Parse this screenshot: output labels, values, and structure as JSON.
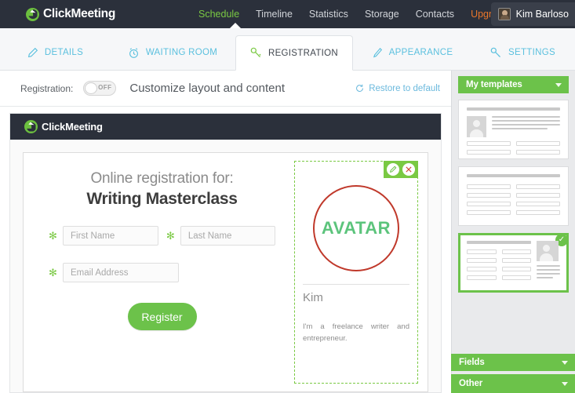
{
  "topbar": {
    "brand": "ClickMeeting",
    "brand_logo_icon": "clickmeeting-cursor-logo",
    "nav": [
      {
        "label": "Schedule",
        "state": "active"
      },
      {
        "label": "Timeline",
        "state": "normal"
      },
      {
        "label": "Statistics",
        "state": "normal"
      },
      {
        "label": "Storage",
        "state": "normal"
      },
      {
        "label": "Contacts",
        "state": "normal"
      },
      {
        "label": "Upgrade",
        "state": "upgrade"
      }
    ],
    "user_name": "Kim Barloso",
    "user_avatar_icon": "user-avatar-thumbnail",
    "colors": {
      "bg": "#2b303b",
      "active": "#7ac943",
      "upgrade": "#e8762b"
    }
  },
  "tabs": [
    {
      "label": "DETAILS",
      "icon": "pencil-icon",
      "active": false
    },
    {
      "label": "WAITING ROOM",
      "icon": "alarm-clock-icon",
      "active": false
    },
    {
      "label": "REGISTRATION",
      "icon": "key-icon",
      "active": true
    },
    {
      "label": "APPEARANCE",
      "icon": "paintbrush-icon",
      "active": false
    },
    {
      "label": "SETTINGS",
      "icon": "wrench-icon",
      "active": false
    }
  ],
  "toolbar": {
    "registration_label": "Registration:",
    "toggle_state": "OFF",
    "title": "Customize layout and content",
    "restore_label": "Restore to default",
    "restore_icon": "restore-circular-arrow-icon"
  },
  "preview": {
    "brand": "ClickMeeting",
    "heading_sub": "Online registration for:",
    "heading_title": "Writing Masterclass",
    "fields": [
      {
        "placeholder": "First Name",
        "required": true
      },
      {
        "placeholder": "Last Name",
        "required": true
      },
      {
        "placeholder": "Email Address",
        "required": true
      }
    ],
    "register_button": "Register",
    "required_marker": "✻",
    "avatar_panel": {
      "edit_icon": "pencil-edit-icon",
      "delete_icon": "close-x-icon",
      "avatar_placeholder": "AVATAR",
      "name": "Kim",
      "description": "I'm a freelance writer and entrepreneur."
    }
  },
  "sidebar": {
    "my_templates_label": "My templates",
    "fields_label": "Fields",
    "other_label": "Other",
    "templates": [
      {
        "id": 1,
        "selected": false,
        "layout": "photo-left"
      },
      {
        "id": 2,
        "selected": false,
        "layout": "two-column"
      },
      {
        "id": 3,
        "selected": true,
        "layout": "photo-right"
      }
    ],
    "selected_badge_icon": "check-circle-icon",
    "accent_color": "#6cc24a"
  }
}
